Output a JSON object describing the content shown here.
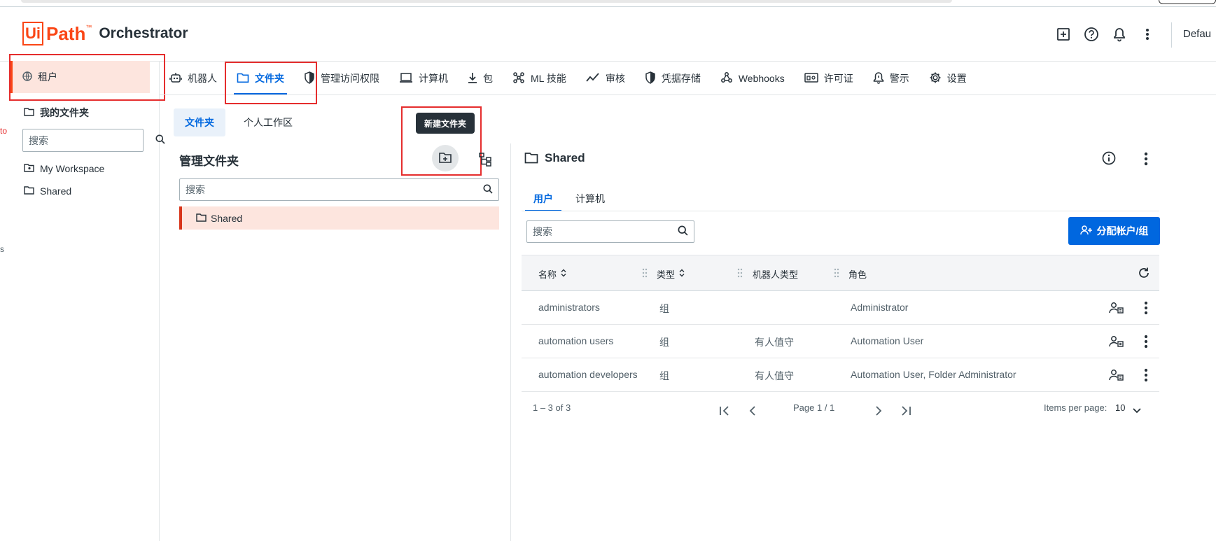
{
  "app": {
    "logo_ui": "Ui",
    "logo_path": "Path",
    "logo_tm": "™",
    "logo_product": "Orchestrator",
    "tenant_label_cut": "Defau"
  },
  "header_icons": [
    "add-box-icon",
    "help-icon",
    "bell-icon",
    "more-vertical-icon"
  ],
  "left_nav": {
    "tenant": "租户",
    "my_folders": "我的文件夹",
    "search_placeholder": "搜索",
    "items": [
      "My Workspace",
      "Shared"
    ]
  },
  "edge_fragments": [
    "to",
    "s"
  ],
  "tabs": [
    {
      "label": "机器人",
      "icon": "robot-icon",
      "active": false
    },
    {
      "label": "文件夹",
      "icon": "folder-icon",
      "active": true
    },
    {
      "label": "管理访问权限",
      "icon": "shield-icon",
      "active": false
    },
    {
      "label": "计算机",
      "icon": "laptop-icon",
      "active": false
    },
    {
      "label": "包",
      "icon": "download-icon",
      "active": false
    },
    {
      "label": "ML 技能",
      "icon": "ml-skill-icon",
      "active": false
    },
    {
      "label": "审核",
      "icon": "trend-icon",
      "active": false
    },
    {
      "label": "凭据存储",
      "icon": "shield-icon",
      "active": false
    },
    {
      "label": "Webhooks",
      "icon": "webhook-icon",
      "active": false
    },
    {
      "label": "许可证",
      "icon": "license-icon",
      "active": false
    },
    {
      "label": "警示",
      "icon": "alert-bell-icon",
      "active": false
    },
    {
      "label": "设置",
      "icon": "gear-icon",
      "active": false
    }
  ],
  "subtabs": {
    "folders": "文件夹",
    "personal_workspaces": "个人工作区"
  },
  "tooltip": "新建文件夹",
  "folder_panel": {
    "title": "管理文件夹",
    "search_placeholder": "搜索",
    "selected_folder": "Shared"
  },
  "detail_panel": {
    "title": "Shared",
    "tabs": {
      "users": "用户",
      "machines": "计算机"
    },
    "search_placeholder": "搜索",
    "assign_button": "分配帐户/组",
    "columns": {
      "name": "名称",
      "type": "类型",
      "robot_type": "机器人类型",
      "roles": "角色"
    },
    "rows": [
      {
        "name": "administrators",
        "type": "组",
        "robot_type": "",
        "roles": "Administrator"
      },
      {
        "name": "automation users",
        "type": "组",
        "robot_type": "有人值守",
        "roles": "Automation User"
      },
      {
        "name": "automation developers",
        "type": "组",
        "robot_type": "有人值守",
        "roles": "Automation User, Folder Administrator"
      }
    ],
    "pagination": {
      "range": "1 – 3 of 3",
      "page": "Page 1 / 1",
      "items_per_page_label": "Items per page:",
      "items_per_page": "10"
    }
  },
  "colors": {
    "brand": "#fa4616",
    "primary": "#0067df",
    "highlight": "#e52d2d",
    "selected_bg": "#fde5de"
  }
}
